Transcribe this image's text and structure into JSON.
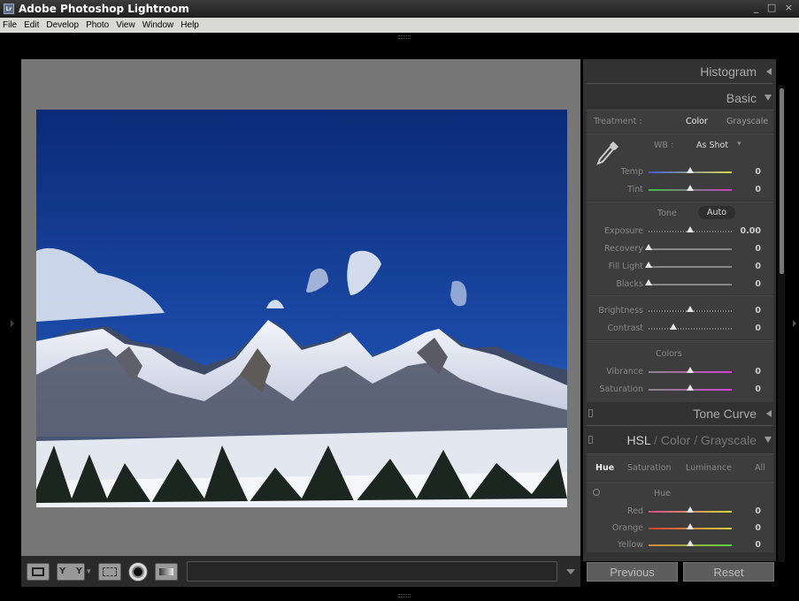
{
  "window": {
    "title": "Adobe Photoshop Lightroom",
    "badge": "Lr",
    "controls": "_ □ ×"
  },
  "menu": [
    "File",
    "Edit",
    "Develop",
    "Photo",
    "View",
    "Window",
    "Help"
  ],
  "toolbar": {
    "yy_left": "Y",
    "yy_right": "Y",
    "dropdown": "▾"
  },
  "panels": {
    "histogram": "Histogram",
    "basic": {
      "title": "Basic",
      "treatment_label": "Treatment :",
      "treatment_color": "Color",
      "treatment_grayscale": "Grayscale",
      "wb_label": "WB :",
      "wb_value": "As Shot",
      "wb_arrow": "▾",
      "temp": {
        "label": "Temp",
        "value": "0",
        "position": 0.5
      },
      "tint": {
        "label": "Tint",
        "value": "0",
        "position": 0.5
      },
      "tone_label": "Tone",
      "auto": "Auto",
      "exposure": {
        "label": "Exposure",
        "value": "0.00",
        "position": 0.5
      },
      "recovery": {
        "label": "Recovery",
        "value": "0",
        "position": 0.0
      },
      "fill_light": {
        "label": "Fill Light",
        "value": "0",
        "position": 0.0
      },
      "blacks": {
        "label": "Blacks",
        "value": "0",
        "position": 0.0
      },
      "brightness": {
        "label": "Brightness",
        "value": "0",
        "position": 0.5
      },
      "contrast": {
        "label": "Contrast",
        "value": "0",
        "position": 0.3
      },
      "colors_label": "Colors",
      "vibrance": {
        "label": "Vibrance",
        "value": "0",
        "position": 0.5
      },
      "saturation": {
        "label": "Saturation",
        "value": "0",
        "position": 0.5
      }
    },
    "tone_curve": "Tone Curve",
    "hsl": {
      "hsl": "HSL",
      "slash": "/",
      "color": "Color",
      "grayscale": "Grayscale",
      "tabs": [
        "Hue",
        "Saturation",
        "Luminance",
        "All"
      ],
      "section": "Hue",
      "red": {
        "label": "Red",
        "value": "0",
        "position": 0.5
      },
      "orange": {
        "label": "Orange",
        "value": "0",
        "position": 0.5
      },
      "yellow": {
        "label": "Yellow",
        "value": "0",
        "position": 0.5
      }
    },
    "previous": "Previous",
    "reset": "Reset"
  },
  "colors": {
    "temp_track": [
      "#3b5bd6",
      "#d8d84a"
    ],
    "tint_track": [
      "#3fbf3f",
      "#c43fc4"
    ],
    "vibrance_track": [
      "#888888",
      "#d63fd6"
    ],
    "red_track": [
      "#d64a8a",
      "#d6d63a"
    ],
    "orange_track": [
      "#d63a3a",
      "#d6d63a"
    ],
    "yellow_track": [
      "#d68a3a",
      "#5ad63a"
    ]
  }
}
